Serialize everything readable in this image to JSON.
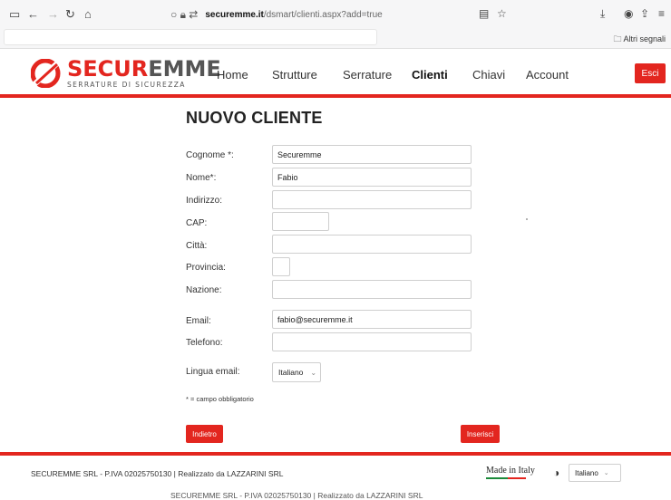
{
  "browser": {
    "url_host": "securemme.it",
    "url_path": "/dsmart/clienti.aspx?add=true",
    "bookmarks_label": "Altri segnali"
  },
  "header": {
    "brand_red": "SECUR",
    "brand_grey": "EMME",
    "tagline": "SERRATURE DI SICUREZZA",
    "nav": [
      "Home",
      "Strutture",
      "Serrature",
      "Clienti",
      "Chiavi",
      "Account"
    ],
    "active_nav": "Clienti",
    "logout_label": "Esci"
  },
  "form": {
    "title": "NUOVO CLIENTE",
    "labels": {
      "cognome": "Cognome *:",
      "nome": "Nome*:",
      "indirizzo": "Indirizzo:",
      "cap": "CAP:",
      "citta": "Città:",
      "provincia": "Provincia:",
      "nazione": "Nazione:",
      "email": "Email:",
      "telefono": "Telefono:",
      "lingua": "Lingua email:"
    },
    "values": {
      "cognome": "Securemme",
      "nome": "Fabio",
      "indirizzo": "",
      "cap": "",
      "citta": "",
      "provincia": "",
      "nazione": "",
      "email": "fabio@securemme.it",
      "telefono": ""
    },
    "lingua_selected": "Italiano",
    "required_note": "* = campo obbligatorio",
    "back_label": "Indietro",
    "submit_label": "Inserisci"
  },
  "footer": {
    "company": "SECUREMME SRL - P.IVA 02025750130  |  Realizzato da LAZZARINI SRL",
    "made_in_italy": "Made in Italy",
    "language_selected": "Italiano",
    "company_repeat": "SECUREMME SRL - P.IVA 02025750130  |  Realizzato da LAZZARINI SRL"
  },
  "colors": {
    "brand_red": "#e3261f",
    "italy_green": "#1b8a3a"
  }
}
